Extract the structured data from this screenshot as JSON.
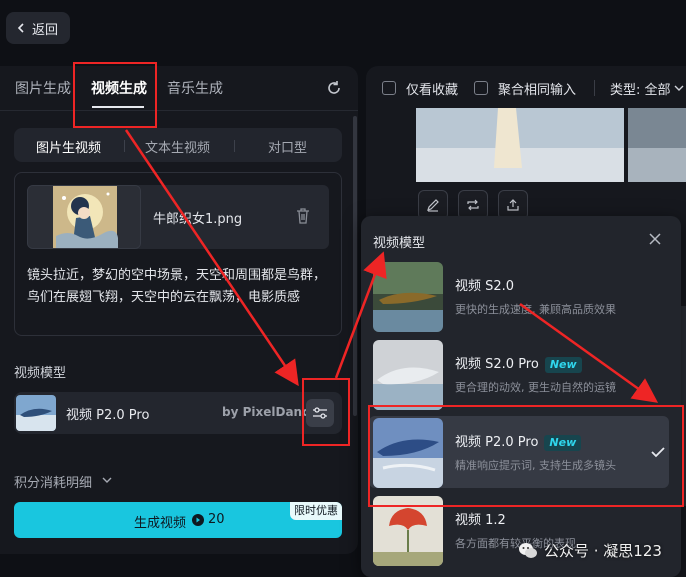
{
  "back": {
    "label": "返回"
  },
  "left_panel": {
    "tabs": [
      {
        "label": "图片生成",
        "active": false
      },
      {
        "label": "视频生成",
        "active": true
      },
      {
        "label": "音乐生成",
        "active": false
      }
    ],
    "sub_tabs": [
      {
        "label": "图片生视频",
        "active": true
      },
      {
        "label": "文本生视频",
        "active": false
      },
      {
        "label": "对口型",
        "active": false
      }
    ],
    "upload": {
      "file_name": "牛郎织女1.png"
    },
    "prompt": "镜头拉近，梦幻的空中场景，天空和周围都是鸟群，鸟们在展翅飞翔，天空中的云在飘荡，电影质感",
    "model_section_label": "视频模型",
    "model": {
      "name": "视频 P2.0 Pro",
      "vendor": "by PixelDance"
    },
    "cost_label": "积分消耗明细",
    "generate": {
      "label": "生成视频",
      "credits": "20",
      "badge": "限时优惠"
    }
  },
  "right_panel": {
    "filters": {
      "favorites_only": "仅看收藏",
      "merge_inputs": "聚合相同输入",
      "type": "类型: 全部"
    }
  },
  "model_popup": {
    "title": "视频模型",
    "options": [
      {
        "name": "视频 S2.0",
        "badge": "",
        "desc": "更快的生成速度, 兼顾高品质效果",
        "selected": false
      },
      {
        "name": "视频 S2.0 Pro",
        "badge": "New",
        "desc": "更合理的动效, 更生动自然的运镜",
        "selected": false
      },
      {
        "name": "视频 P2.0 Pro",
        "badge": "New",
        "desc": "精准响应提示词, 支持生成多镜头",
        "selected": true
      },
      {
        "name": "视频 1.2",
        "badge": "",
        "desc": "各方面都有较平衡的表现",
        "selected": false
      }
    ]
  },
  "watermark": {
    "text": "公众号 · 凝思123"
  },
  "colors": {
    "accent": "#19c6df",
    "annotation": "#ee2525",
    "new_badge": "#2fd6ec"
  }
}
